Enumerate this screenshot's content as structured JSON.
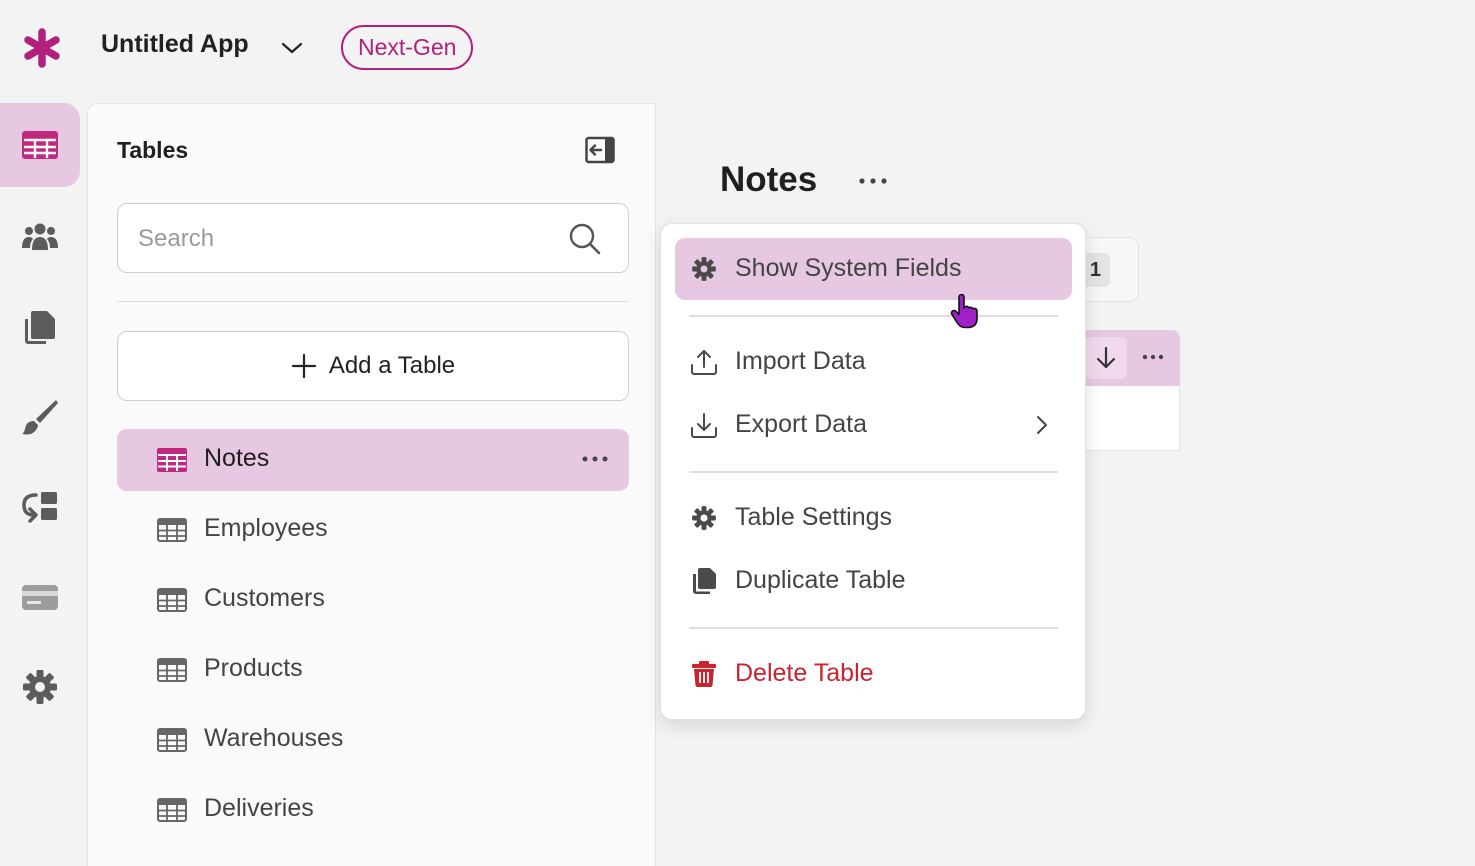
{
  "header": {
    "app_name": "Untitled App",
    "badge": "Next-Gen",
    "logo_icon": "asterisk-logo-icon",
    "accent_color": "#b2207d"
  },
  "rail": {
    "items": [
      {
        "icon": "table-grid-icon",
        "active": true
      },
      {
        "icon": "users-icon",
        "active": false
      },
      {
        "icon": "pages-icon",
        "active": false
      },
      {
        "icon": "paintbrush-icon",
        "active": false
      },
      {
        "icon": "flows-icon",
        "active": false
      },
      {
        "icon": "payment-card-icon",
        "active": false
      },
      {
        "icon": "gear-icon",
        "active": false
      }
    ]
  },
  "tables_panel": {
    "title": "Tables",
    "search_placeholder": "Search",
    "add_table_label": "Add a Table",
    "tables": [
      {
        "label": "Notes",
        "active": true
      },
      {
        "label": "Employees",
        "active": false
      },
      {
        "label": "Customers",
        "active": false
      },
      {
        "label": "Products",
        "active": false
      },
      {
        "label": "Warehouses",
        "active": false
      },
      {
        "label": "Deliveries",
        "active": false
      }
    ]
  },
  "main": {
    "title": "Notes",
    "record_count": "1"
  },
  "context_menu": {
    "items": [
      {
        "label": "Show System Fields",
        "icon": "gear-icon",
        "highlighted": true
      },
      {
        "label": "Import Data",
        "icon": "upload-icon"
      },
      {
        "label": "Export Data",
        "icon": "download-icon",
        "submenu": true
      },
      {
        "label": "Table Settings",
        "icon": "gear-icon"
      },
      {
        "label": "Duplicate Table",
        "icon": "copy-icon"
      },
      {
        "label": "Delete Table",
        "icon": "trash-icon",
        "danger": true
      }
    ],
    "danger_color": "#c8232f",
    "highlight_color": "#e6c8e2"
  }
}
